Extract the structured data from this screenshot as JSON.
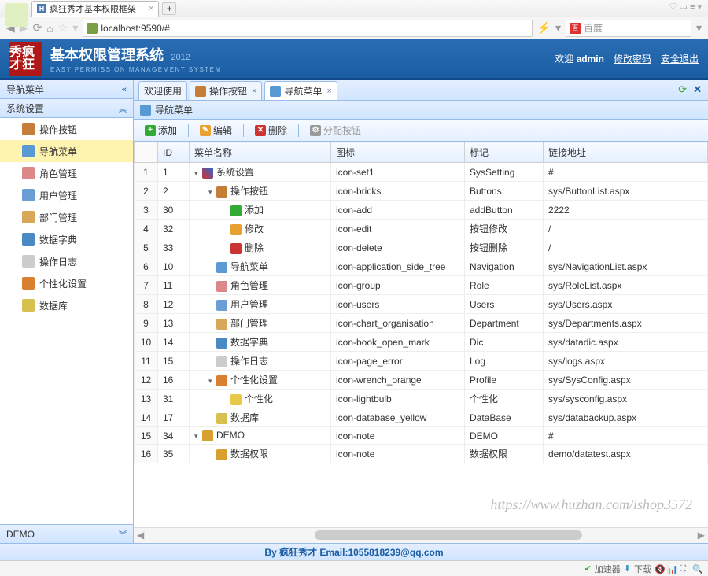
{
  "browser": {
    "tab_title": "疯狂秀才基本权限框架",
    "address": "localhost:9590/#",
    "search_placeholder": "百度",
    "lightning": "⚡",
    "dropdown": "▾"
  },
  "header": {
    "logo": "秀疯\n才狂",
    "title": "基本权限管理系统",
    "year": "2012",
    "subtitle": "EASY PERMISSION MANAGEMENT SYSTEM",
    "welcome_prefix": "欢迎",
    "username": "admin",
    "change_pwd": "修改密码",
    "logout": "安全退出"
  },
  "sidebar": {
    "header": "导航菜单",
    "group": "系统设置",
    "items": [
      {
        "label": "操作按钮",
        "cls": "i-bricks"
      },
      {
        "label": "导航菜单",
        "cls": "i-nav",
        "active": true
      },
      {
        "label": "角色管理",
        "cls": "i-group"
      },
      {
        "label": "用户管理",
        "cls": "i-users"
      },
      {
        "label": "部门管理",
        "cls": "i-org"
      },
      {
        "label": "数据字典",
        "cls": "i-book"
      },
      {
        "label": "操作日志",
        "cls": "i-page"
      },
      {
        "label": "个性化设置",
        "cls": "i-wrench"
      },
      {
        "label": "数据库",
        "cls": "i-db"
      }
    ],
    "footer_group": "DEMO"
  },
  "tabs": [
    {
      "label": "欢迎使用",
      "cls": "",
      "closable": false
    },
    {
      "label": "操作按钮",
      "cls": "i-bricks",
      "closable": true
    },
    {
      "label": "导航菜单",
      "cls": "i-nav",
      "closable": true,
      "active": true
    }
  ],
  "panel": {
    "title": "导航菜单"
  },
  "toolbar": {
    "add": "添加",
    "edit": "编辑",
    "del": "删除",
    "assign": "分配按钮"
  },
  "grid": {
    "cols": {
      "rownum": "",
      "id": "ID",
      "name": "菜单名称",
      "icon": "图标",
      "tag": "标记",
      "url": "链接地址"
    },
    "rows": [
      {
        "n": 1,
        "id": "1",
        "indent": 0,
        "open": true,
        "cls": "i-tools",
        "name": "系统设置",
        "icon": "icon-set1",
        "tag": "SysSetting",
        "url": "#"
      },
      {
        "n": 2,
        "id": "2",
        "indent": 1,
        "open": true,
        "cls": "i-bricks",
        "name": "操作按钮",
        "icon": "icon-bricks",
        "tag": "Buttons",
        "url": "sys/ButtonList.aspx"
      },
      {
        "n": 3,
        "id": "30",
        "indent": 2,
        "cls": "i-add",
        "name": "添加",
        "icon": "icon-add",
        "tag": "addButton",
        "url": "2222"
      },
      {
        "n": 4,
        "id": "32",
        "indent": 2,
        "cls": "i-edit",
        "name": "修改",
        "icon": "icon-edit",
        "tag": "按钮修改",
        "url": "/"
      },
      {
        "n": 5,
        "id": "33",
        "indent": 2,
        "cls": "i-del",
        "name": "删除",
        "icon": "icon-delete",
        "tag": "按钮删除",
        "url": "/"
      },
      {
        "n": 6,
        "id": "10",
        "indent": 1,
        "cls": "i-nav",
        "name": "导航菜单",
        "icon": "icon-application_side_tree",
        "tag": "Navigation",
        "url": "sys/NavigationList.aspx"
      },
      {
        "n": 7,
        "id": "11",
        "indent": 1,
        "cls": "i-group",
        "name": "角色管理",
        "icon": "icon-group",
        "tag": "Role",
        "url": "sys/RoleList.aspx"
      },
      {
        "n": 8,
        "id": "12",
        "indent": 1,
        "cls": "i-users",
        "name": "用户管理",
        "icon": "icon-users",
        "tag": "Users",
        "url": "sys/Users.aspx"
      },
      {
        "n": 9,
        "id": "13",
        "indent": 1,
        "cls": "i-org",
        "name": "部门管理",
        "icon": "icon-chart_organisation",
        "tag": "Department",
        "url": "sys/Departments.aspx"
      },
      {
        "n": 10,
        "id": "14",
        "indent": 1,
        "cls": "i-book",
        "name": "数据字典",
        "icon": "icon-book_open_mark",
        "tag": "Dic",
        "url": "sys/datadic.aspx"
      },
      {
        "n": 11,
        "id": "15",
        "indent": 1,
        "cls": "i-page",
        "name": "操作日志",
        "icon": "icon-page_error",
        "tag": "Log",
        "url": "sys/logs.aspx"
      },
      {
        "n": 12,
        "id": "16",
        "indent": 1,
        "open": true,
        "cls": "i-wrench",
        "name": "个性化设置",
        "icon": "icon-wrench_orange",
        "tag": "Profile",
        "url": "sys/SysConfig.aspx"
      },
      {
        "n": 13,
        "id": "31",
        "indent": 2,
        "cls": "i-bulb",
        "name": "个性化",
        "icon": "icon-lightbulb",
        "tag": "个性化",
        "url": "sys/sysconfig.aspx"
      },
      {
        "n": 14,
        "id": "17",
        "indent": 1,
        "cls": "i-db",
        "name": "数据库",
        "icon": "icon-database_yellow",
        "tag": "DataBase",
        "url": "sys/databackup.aspx"
      },
      {
        "n": 15,
        "id": "34",
        "indent": 0,
        "open": true,
        "cls": "i-note",
        "name": "DEMO",
        "icon": "icon-note",
        "tag": "DEMO",
        "url": "#"
      },
      {
        "n": 16,
        "id": "35",
        "indent": 1,
        "cls": "i-note",
        "name": "数据权限",
        "icon": "icon-note",
        "tag": "数据权限",
        "url": "demo/datatest.aspx"
      }
    ]
  },
  "watermark": "https://www.huzhan.com/ishop3572",
  "footer": "By 疯狂秀才 Email:1055818239@qq.com",
  "status": {
    "accel": "加速器",
    "download": "下载"
  }
}
